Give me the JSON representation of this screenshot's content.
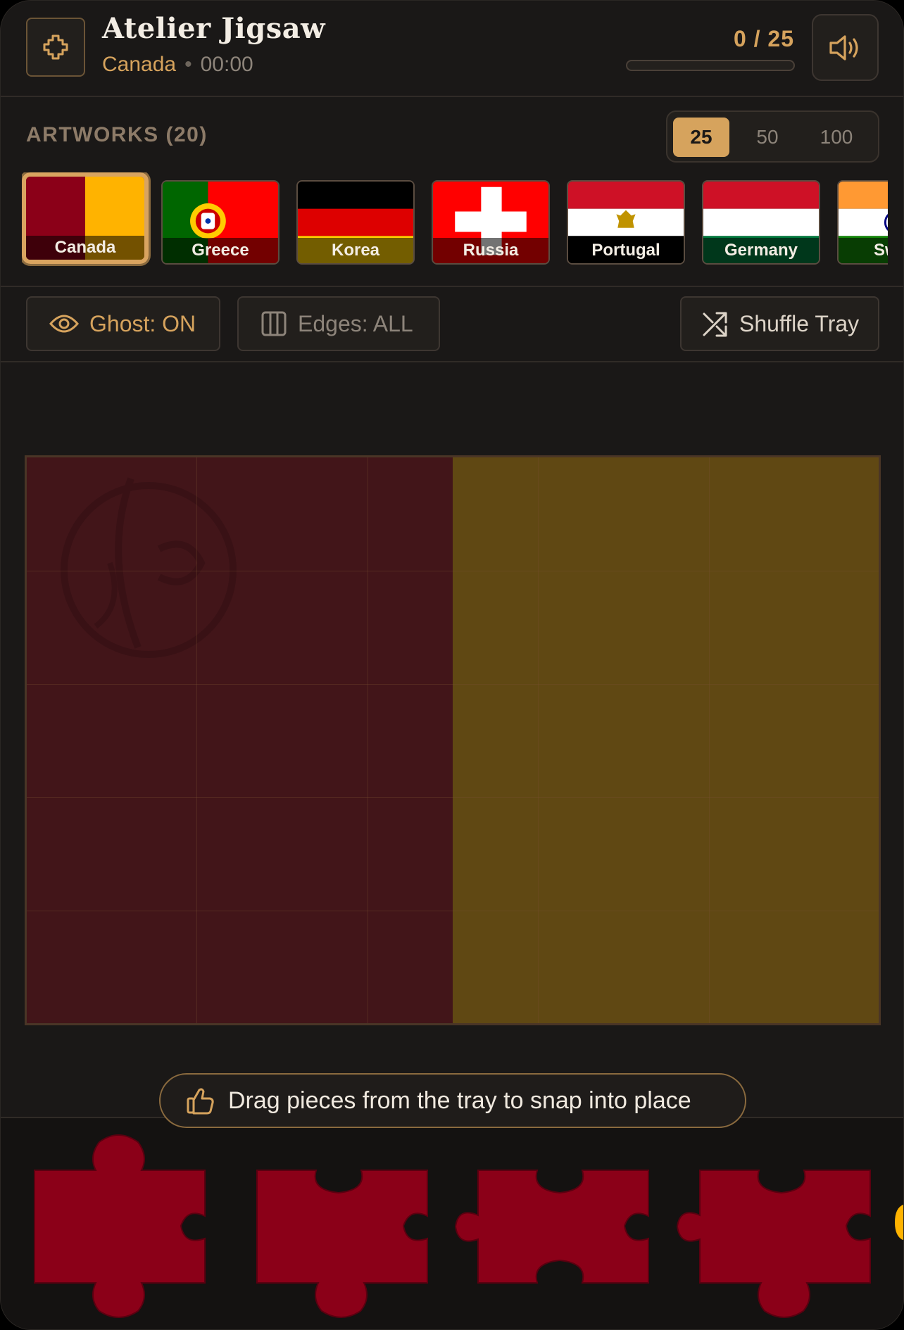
{
  "header": {
    "title": "Atelier Jigsaw",
    "current_artwork": "Canada",
    "separator": "•",
    "timer": "00:00",
    "progress_label": "0 / 25",
    "progress_fraction": 0
  },
  "artworks": {
    "label": "ARTWORKS (20)",
    "piece_counts": [
      "25",
      "50",
      "100"
    ],
    "selected_count": "25",
    "items": [
      {
        "label": "Canada"
      },
      {
        "label": "Greece"
      },
      {
        "label": "Korea"
      },
      {
        "label": "Russia"
      },
      {
        "label": "Portugal"
      },
      {
        "label": "Germany"
      },
      {
        "label": "Sw"
      }
    ]
  },
  "toolbar": {
    "ghost_label": "Ghost: ON",
    "edges_label": "Edges: ALL",
    "shuffle_label": "Shuffle Tray"
  },
  "board": {
    "rows": 5,
    "cols": 5
  },
  "hint": "Drag pieces from the tray to snap into place",
  "colors": {
    "accent": "#d6a35d",
    "piece": "#8b0018",
    "board_left": "#421519",
    "board_right": "#604813"
  },
  "icons": {
    "logo": "puzzle-piece-icon",
    "sound": "speaker-icon",
    "ghost": "eye-icon",
    "edges": "columns-icon",
    "shuffle": "shuffle-icon",
    "hint": "thumbs-up-icon"
  }
}
